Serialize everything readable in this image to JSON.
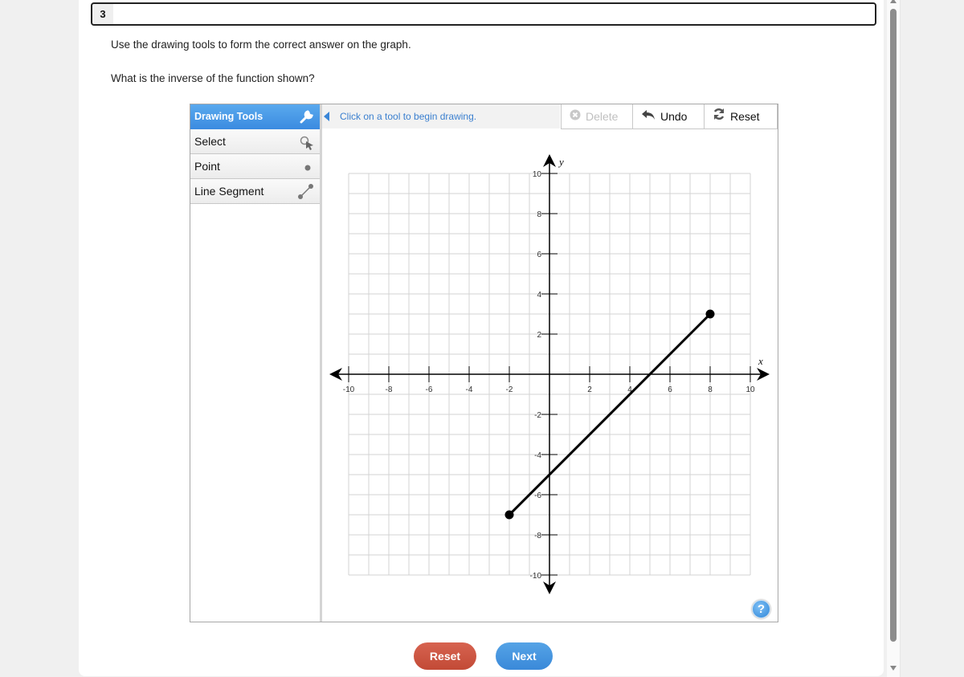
{
  "question": {
    "number": "3",
    "instruction": "Use the drawing tools to form the correct answer on the graph.",
    "prompt": "What is the inverse of the function shown?"
  },
  "drawing_tools": {
    "header": "Drawing Tools",
    "header_icon": "wrench-icon",
    "items": [
      {
        "label": "Select",
        "icon": "select-pointer-icon"
      },
      {
        "label": "Point",
        "icon": "point-icon"
      },
      {
        "label": "Line Segment",
        "icon": "line-segment-icon"
      }
    ]
  },
  "message": "Click on a tool to begin drawing.",
  "toolbar": {
    "delete_label": "Delete",
    "delete_enabled": false,
    "undo_label": "Undo",
    "reset_label": "Reset"
  },
  "help_label": "?",
  "footer": {
    "reset_label": "Reset",
    "next_label": "Next"
  },
  "colors": {
    "accent_blue": "#3b8be0",
    "reset_red": "#c24a36",
    "grid": "#d3d3d3",
    "axis": "#000000"
  },
  "chart_data": {
    "type": "line",
    "xlabel": "x",
    "ylabel": "y",
    "xlim": [
      -10,
      10
    ],
    "ylim": [
      -10,
      10
    ],
    "grid": true,
    "grid_step": 1,
    "x_ticks": [
      -10,
      -8,
      -6,
      -4,
      -2,
      2,
      4,
      6,
      8,
      10
    ],
    "y_ticks": [
      10,
      8,
      6,
      4,
      2,
      -2,
      -4,
      -6,
      -8,
      -10
    ],
    "series": [
      {
        "name": "function segment",
        "points": [
          [
            -2,
            -7
          ],
          [
            8,
            3
          ]
        ],
        "endpoints": "closed"
      }
    ]
  }
}
